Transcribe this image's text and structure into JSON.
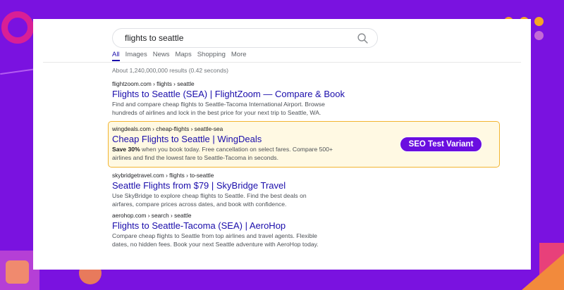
{
  "search": {
    "query": "flights to seattle"
  },
  "tabs": [
    {
      "label": "All",
      "active": true
    },
    {
      "label": "Images"
    },
    {
      "label": "News"
    },
    {
      "label": "Maps"
    },
    {
      "label": "Shopping"
    },
    {
      "label": "More"
    }
  ],
  "stats": "About 1,240,000,000 results (0.42 seconds)",
  "results": [
    {
      "cite": "flightzoom.com › flights › seattle",
      "title": "Flights to Seattle (SEA) | FlightZoom — Compare & Book",
      "snippet_line1": "Find and compare cheap flights to Seattle-Tacoma International Airport. Browse",
      "snippet_line2": "hundreds of airlines and lock in the best price for your next trip to Seattle, WA."
    },
    {
      "cite": "wingdeals.com › cheap-flights › seattle-sea",
      "title": "Cheap Flights to Seattle | WingDeals",
      "snippet_bold": "Save 30%",
      "snippet_line1": " when you book today. Free cancellation on select fares. Compare 500+",
      "snippet_line2": "airlines and find the lowest fare to Seattle-Tacoma in seconds."
    },
    {
      "cite": "skybridgetravel.com › flights › to-seattle",
      "title": "Seattle Flights from $79 | SkyBridge Travel",
      "snippet_line1": "Use SkyBridge to explore cheap flights to Seattle. Find the best deals on",
      "snippet_line2": "airfares, compare prices across dates, and book with confidence."
    },
    {
      "cite": "aerohop.com › search › seattle",
      "title": "Flights to Seattle-Tacoma (SEA) | AeroHop",
      "snippet_line1": "Compare cheap flights to Seattle from top airlines and travel agents. Flexible",
      "snippet_line2": "dates, no hidden fees. Book your next Seattle adventure with AeroHop today."
    }
  ],
  "badge": {
    "label": "SEO Test Variant"
  },
  "colors": {
    "background": "#7a12e0",
    "link": "#1a0dab",
    "highlight_border": "#f2b531",
    "highlight_fill": "#fff9e3",
    "badge": "#6a0ee0",
    "accent_yellow": "#f5a623",
    "accent_pink": "#d91f96"
  },
  "icons": {
    "search": "search-icon"
  }
}
